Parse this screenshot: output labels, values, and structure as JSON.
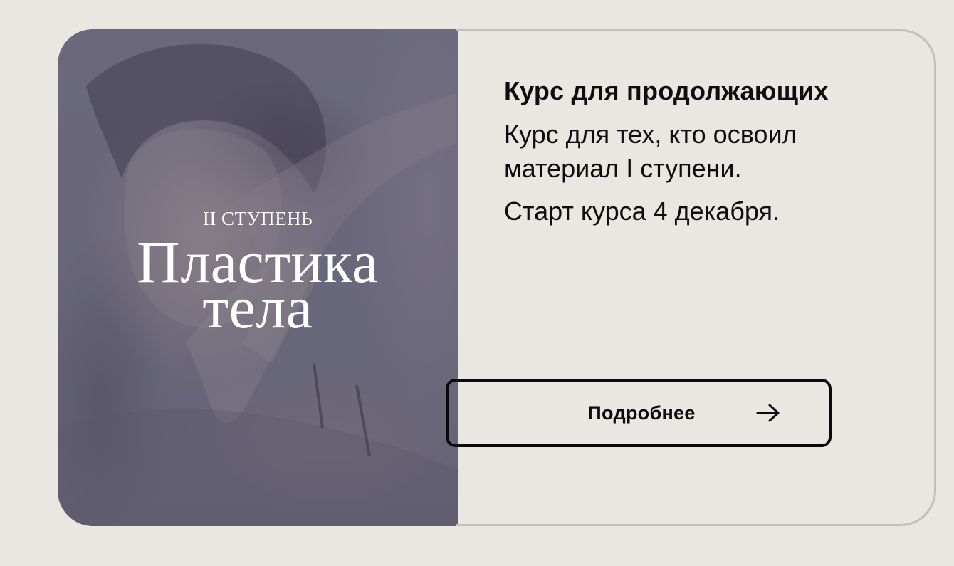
{
  "card": {
    "level_label": "II СТУПЕНЬ",
    "course_title_line1": "Пластика",
    "course_title_line2": "тела",
    "heading": "Курс для продолжающих",
    "description": "Курс для тех, кто освоил материал I ступени.",
    "start_text": "Старт курса 4 декабря.",
    "button_label": "Подробнее",
    "button_icon": "arrow-right-icon"
  },
  "colors": {
    "background": "#e9e7e2",
    "card_border": "#c2c0bb",
    "image_overlay": "#676577",
    "text": "#0e0e0e",
    "button_border": "#0a0a0a",
    "image_text": "#ffffff"
  }
}
